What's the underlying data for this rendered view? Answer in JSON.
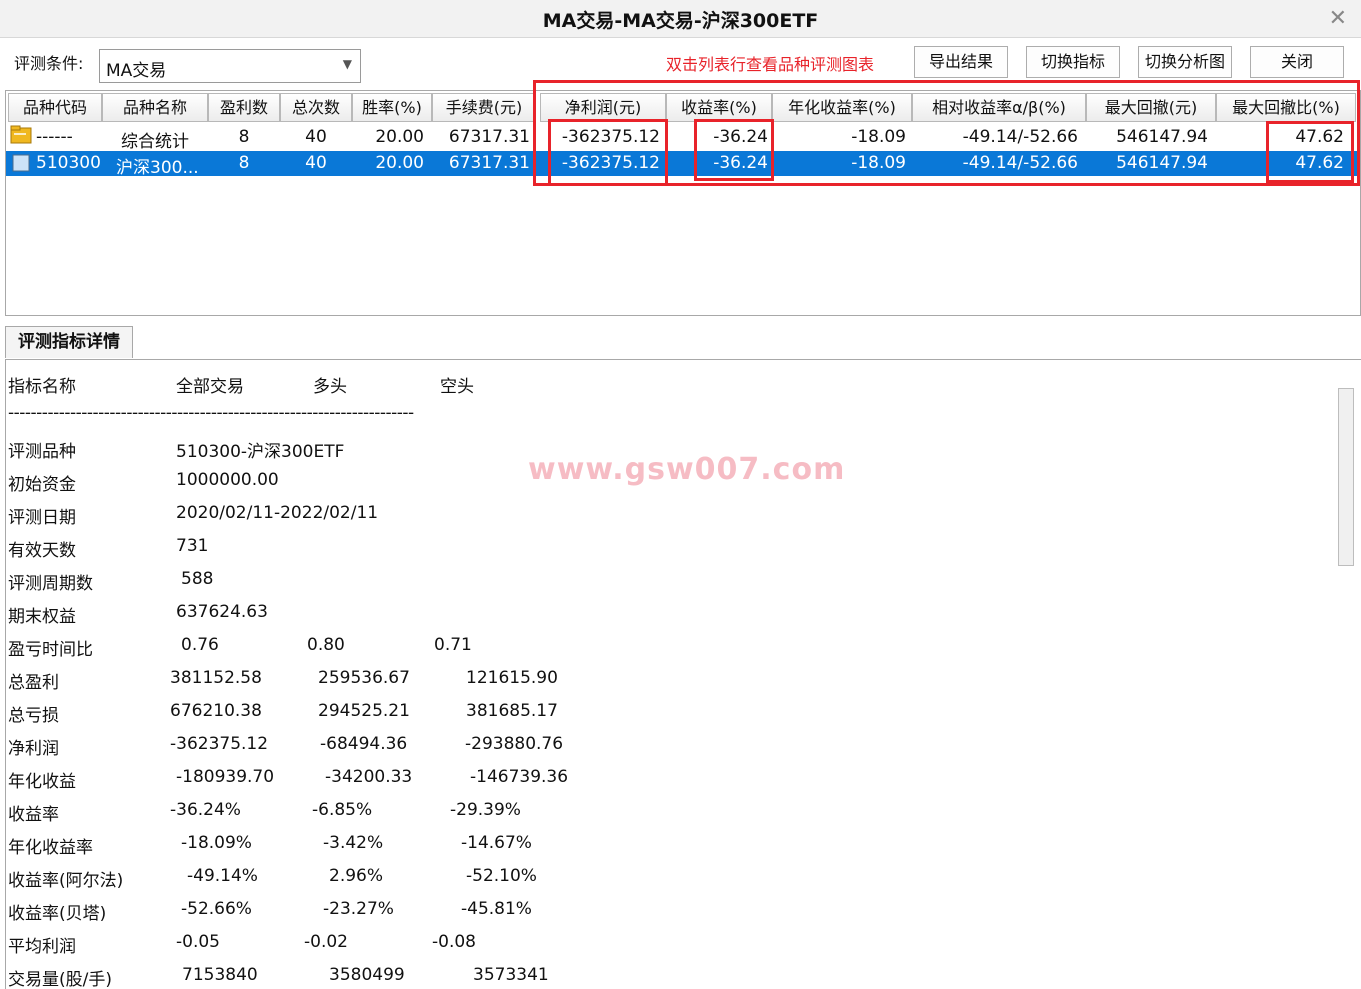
{
  "window": {
    "title": "MA交易-MA交易-沪深300ETF"
  },
  "toolbar": {
    "condition_label": "评测条件:",
    "condition_value": "MA交易",
    "hint": "双击列表行查看品种评测图表",
    "export_label": "导出结果",
    "switch_indicator_label": "切换指标",
    "switch_chart_label": "切换分析图",
    "close_label": "关闭"
  },
  "table": {
    "headers": [
      "品种代码",
      "品种名称",
      "盈利数",
      "总次数",
      "胜率(%)",
      "手续费(元)",
      "净利润(元)",
      "收益率(%)",
      "年化收益率(%)",
      "相对收益率α/β(%)",
      "最大回撤(元)",
      "最大回撤比(%)"
    ],
    "rows": [
      {
        "code": "------",
        "name": "综合统计",
        "win": "8",
        "total": "40",
        "rate": "20.00",
        "fee": "67317.31",
        "net": "-362375.12",
        "ret": "-36.24",
        "annual": "-18.09",
        "rel": "-49.14/-52.66",
        "dd": "546147.94",
        "ddp": "47.62"
      },
      {
        "code": "510300",
        "name": "沪深300...",
        "win": "8",
        "total": "40",
        "rate": "20.00",
        "fee": "67317.31",
        "net": "-362375.12",
        "ret": "-36.24",
        "annual": "-18.09",
        "rel": "-49.14/-52.66",
        "dd": "546147.94",
        "ddp": "47.62"
      }
    ]
  },
  "detail": {
    "tab_label": "评测指标详情",
    "headers": [
      "指标名称",
      "全部交易",
      "多头",
      "空头"
    ],
    "separator": "------------------------------------------------------------------------",
    "info": [
      {
        "label": "评测品种",
        "value": "510300-沪深300ETF"
      },
      {
        "label": "初始资金",
        "value": "1000000.00"
      },
      {
        "label": "评测日期",
        "value": "2020/02/11-2022/02/11"
      },
      {
        "label": "有效天数",
        "value": "731"
      },
      {
        "label": "评测周期数",
        "value": "588"
      },
      {
        "label": "期末权益",
        "value": "637624.63"
      }
    ],
    "metrics": [
      {
        "label": "盈亏时间比",
        "all": "0.76",
        "long": "0.80",
        "short": "0.71"
      },
      {
        "label": "总盈利",
        "all": "381152.58",
        "long": "259536.67",
        "short": "121615.90"
      },
      {
        "label": "总亏损",
        "all": "676210.38",
        "long": "294525.21",
        "short": "381685.17"
      },
      {
        "label": "净利润",
        "all": "-362375.12",
        "long": "-68494.36",
        "short": "-293880.76"
      },
      {
        "label": "年化收益",
        "all": "-180939.70",
        "long": "-34200.33",
        "short": "-146739.36"
      },
      {
        "label": "收益率",
        "all": "-36.24%",
        "long": "-6.85%",
        "short": "-29.39%"
      },
      {
        "label": "年化收益率",
        "all": "-18.09%",
        "long": "-3.42%",
        "short": "-14.67%"
      },
      {
        "label": "收益率(阿尔法)",
        "all": "-49.14%",
        "long": "2.96%",
        "short": "-52.10%"
      },
      {
        "label": "收益率(贝塔)",
        "all": "-52.66%",
        "long": "-23.27%",
        "short": "-45.81%"
      },
      {
        "label": "平均利润",
        "all": "-0.05",
        "long": "-0.02",
        "short": "-0.08"
      },
      {
        "label": "交易量(股/手)",
        "all": "7153840",
        "long": "3580499",
        "short": "3573341"
      }
    ]
  },
  "watermark": "www.gsw007.com",
  "colors": {
    "selection": "#0a78d7",
    "highlight": "#e8232a"
  }
}
